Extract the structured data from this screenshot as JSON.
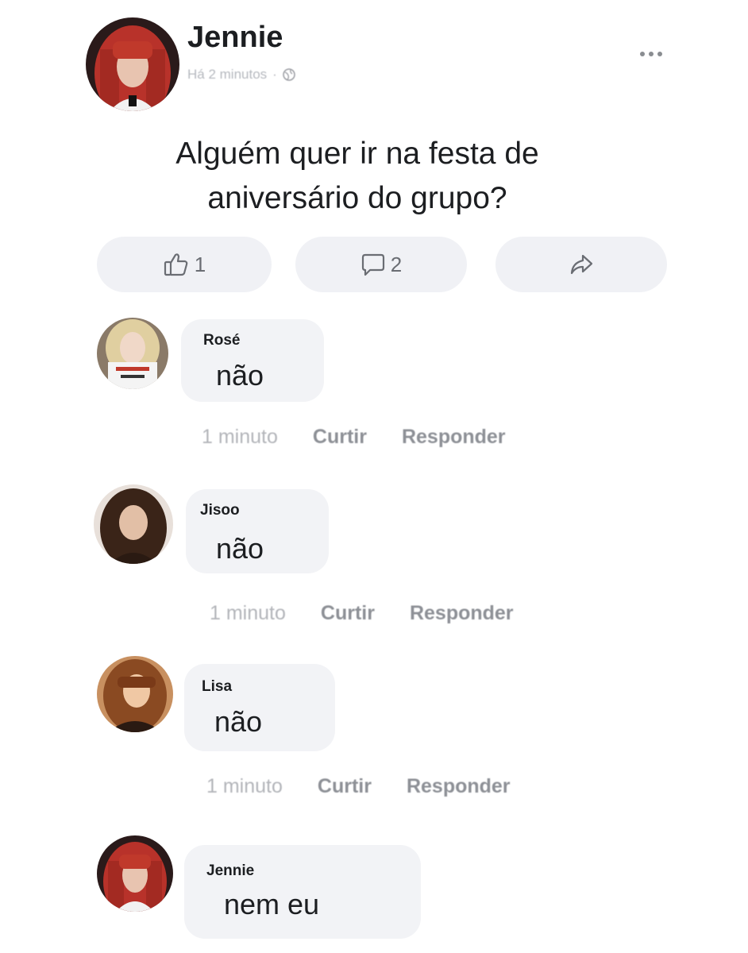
{
  "post": {
    "author": "Jennie",
    "meta_time": "Há 2 minutos",
    "meta_separator": "·",
    "text": "Alguém quer ir na festa de aniversário do grupo?",
    "more_icon": "more-horizontal-icon"
  },
  "actions": {
    "like_count": "1",
    "comment_count": "2",
    "like_icon": "thumbs-up-icon",
    "comment_icon": "comment-icon",
    "share_icon": "share-icon"
  },
  "comments": [
    {
      "name": "Rosé",
      "text": "não",
      "time": "1 minuto",
      "like": "Curtir",
      "reply": "Responder"
    },
    {
      "name": "Jisoo",
      "text": "não",
      "time": "1 minuto",
      "like": "Curtir",
      "reply": "Responder"
    },
    {
      "name": "Lisa",
      "text": "não",
      "time": "1 minuto",
      "like": "Curtir",
      "reply": "Responder"
    },
    {
      "name": "Jennie",
      "text": "nem eu"
    }
  ],
  "colors": {
    "text_primary": "#1c1e21",
    "text_muted": "#9a9ca2",
    "bubble_bg": "#f2f3f6",
    "button_bg": "#f0f1f5"
  }
}
